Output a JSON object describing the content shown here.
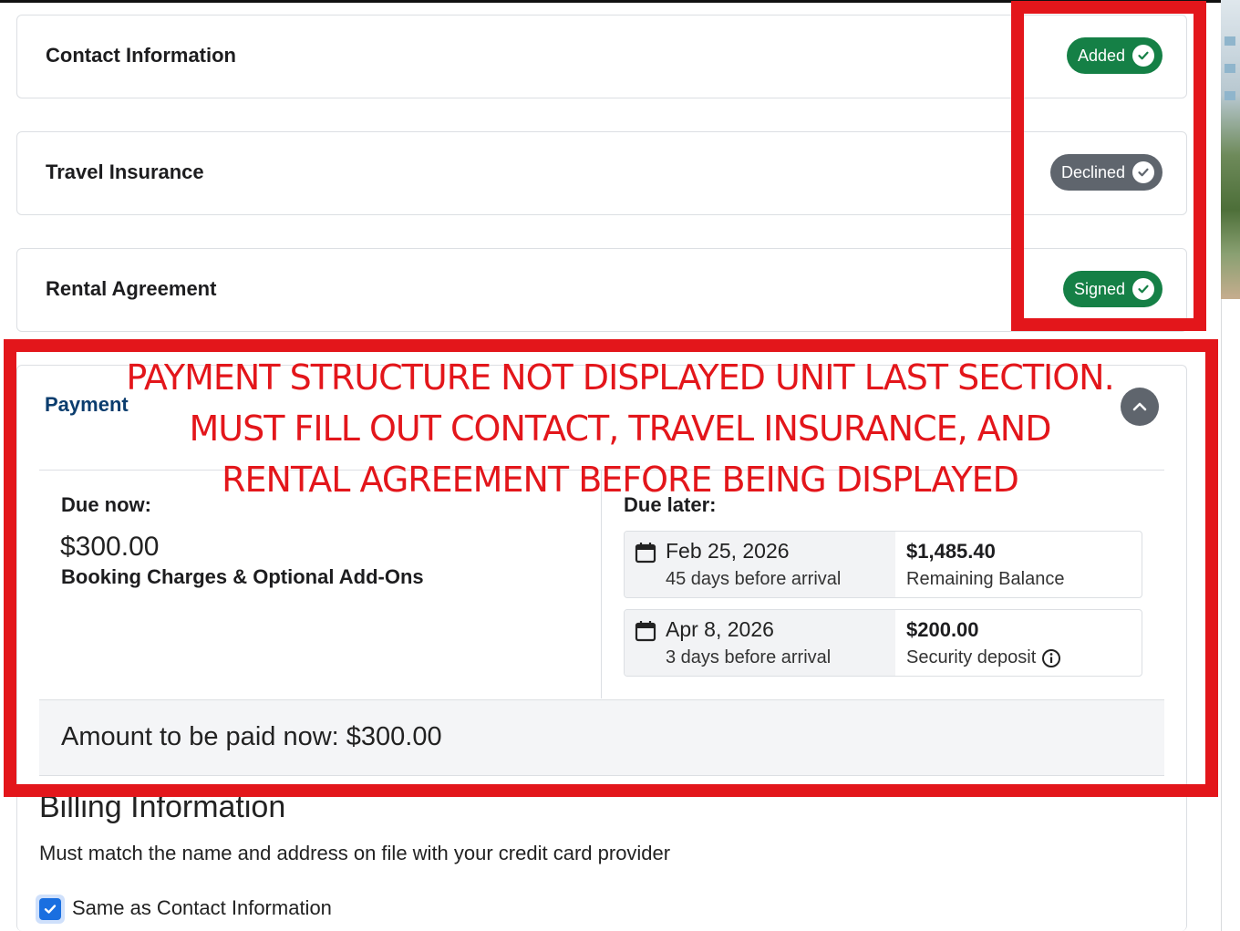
{
  "sections": [
    {
      "title": "Contact Information",
      "status": "Added"
    },
    {
      "title": "Travel Insurance",
      "status": "Declined"
    },
    {
      "title": "Rental Agreement",
      "status": "Signed"
    }
  ],
  "payment": {
    "title": "Payment",
    "due_now": {
      "label": "Due now:",
      "amount": "$300.00",
      "description": "Booking Charges & Optional Add-Ons"
    },
    "due_later": {
      "label": "Due later:",
      "items": [
        {
          "date": "Feb 25, 2026",
          "when": "45 days before arrival",
          "amount": "$1,485.40",
          "kind": "Remaining Balance"
        },
        {
          "date": "Apr 8, 2026",
          "when": "3 days before arrival",
          "amount": "$200.00",
          "kind": "Security deposit"
        }
      ]
    },
    "total": "Amount to be paid now: $300.00"
  },
  "billing": {
    "title": "Billing Information",
    "subtitle": "Must match the name and address on file with your credit card provider",
    "same_as_contact": "Same as Contact Information"
  },
  "annotation": {
    "lines": [
      "PAYMENT STRUCTURE NOT DISPLAYED UNIT LAST SECTION.",
      "MUST FILL OUT CONTACT, TRAVEL INSURANCE, AND",
      "RENTAL AGREEMENT BEFORE BEING DISPLAYED"
    ]
  },
  "colors": {
    "added": "#158046",
    "declined": "#5f656d",
    "signed": "#158046",
    "annotation": "#e3161b",
    "payment_title": "#0b3d6e",
    "checkbox": "#1a6fe0"
  },
  "icons": [
    "check-circle-icon",
    "chevron-up-icon",
    "calendar-icon",
    "info-icon",
    "checkbox-checked-icon"
  ]
}
